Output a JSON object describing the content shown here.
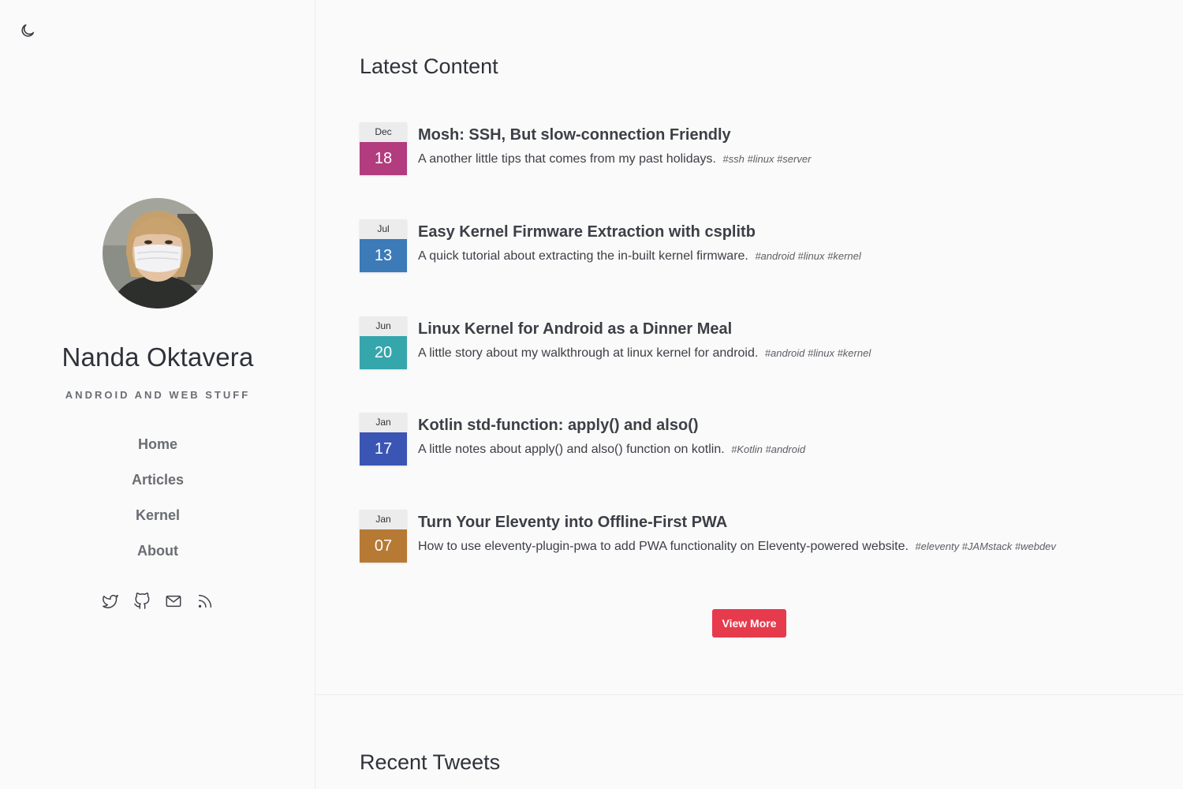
{
  "profile": {
    "name": "Nanda Oktavera",
    "tagline": "ANDROID AND WEB STUFF"
  },
  "nav": {
    "items": [
      {
        "label": "Home"
      },
      {
        "label": "Articles"
      },
      {
        "label": "Kernel"
      },
      {
        "label": "About"
      }
    ]
  },
  "social": [
    "twitter-icon",
    "github-icon",
    "mail-icon",
    "rss-icon"
  ],
  "latest": {
    "title": "Latest Content",
    "posts": [
      {
        "month": "Dec",
        "day": "18",
        "color": "#b23c7e",
        "title": "Mosh: SSH, But slow-connection Friendly",
        "desc": "A another little tips that comes from my past holidays.",
        "tags": "#ssh #linux #server"
      },
      {
        "month": "Jul",
        "day": "13",
        "color": "#3c7ab8",
        "title": "Easy Kernel Firmware Extraction with csplitb",
        "desc": "A quick tutorial about extracting the in-built kernel firmware.",
        "tags": "#android #linux #kernel"
      },
      {
        "month": "Jun",
        "day": "20",
        "color": "#35a6ac",
        "title": "Linux Kernel for Android as a Dinner Meal",
        "desc": "A little story about my walkthrough at linux kernel for android.",
        "tags": "#android #linux #kernel"
      },
      {
        "month": "Jan",
        "day": "17",
        "color": "#3a55b4",
        "title": "Kotlin std-function: apply() and also()",
        "desc": "A little notes about apply() and also() function on kotlin.",
        "tags": "#Kotlin #android"
      },
      {
        "month": "Jan",
        "day": "07",
        "color": "#b67a35",
        "title": "Turn Your Eleventy into Offline-First PWA",
        "desc": "How to use eleventy-plugin-pwa to add PWA functionality on Eleventy-powered website.",
        "tags": "#eleventy #JAMstack #webdev"
      }
    ],
    "view_more": "View More",
    "button_color": "#e63a4d"
  },
  "tweets": {
    "title": "Recent Tweets"
  }
}
